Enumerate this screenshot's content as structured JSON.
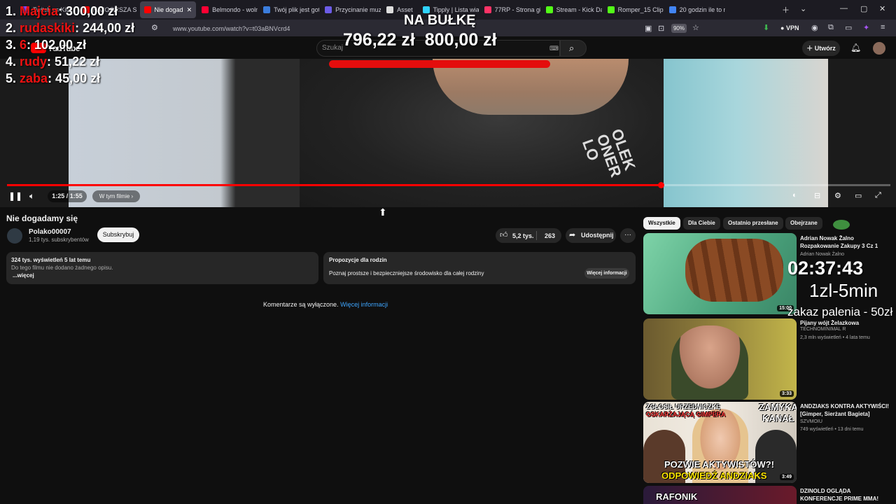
{
  "browser": {
    "tabs": [
      {
        "label": "Twitch vs Kick",
        "color": "#9146ff",
        "active": false
      },
      {
        "label": "NAJGORSZA S",
        "color": "#ff0000",
        "active": false
      },
      {
        "label": "Nie dogad",
        "color": "#ff0000",
        "active": true
      },
      {
        "label": "Belmondo - woln",
        "color": "#ff0033",
        "active": false
      },
      {
        "label": "Twój plik jest got",
        "color": "#3b7ddd",
        "active": false
      },
      {
        "label": "Przycinanie muzy",
        "color": "#6c5ce7",
        "active": false
      },
      {
        "label": "Asset",
        "color": "#dddddd",
        "active": false
      },
      {
        "label": "Tipply | Lista wiad",
        "color": "#2fd3ff",
        "active": false
      },
      {
        "label": "77RP - Strona głó",
        "color": "#ff3366",
        "active": false
      },
      {
        "label": "Stream - Kick Das",
        "color": "#53fc18",
        "active": false
      },
      {
        "label": "Romper_15 Clips",
        "color": "#53fc18",
        "active": false
      },
      {
        "label": "20 godzin ile to m",
        "color": "#4285f4",
        "active": false
      }
    ],
    "url": "www.youtube.com/watch?v=t03aBNVcrd4",
    "zoom": "90%",
    "vpn_label": "VPN"
  },
  "youtube": {
    "logo_text": "YouTube",
    "search_placeholder": "Szukaj",
    "create_label": "Utwórz"
  },
  "overlay": {
    "leaderboard": [
      {
        "rank": "1.",
        "name": "Majcia",
        "amount": ": 300,00 zł"
      },
      {
        "rank": "2.",
        "name": "rudaskiki",
        "amount": ": 244,00 zł"
      },
      {
        "rank": "3.",
        "name": "6",
        "amount": ": 102,00 zł"
      },
      {
        "rank": "4.",
        "name": "rudy",
        "amount": ": 51,22 zł"
      },
      {
        "rank": "5.",
        "name": "zaba",
        "amount": ": 45,00 zł"
      }
    ],
    "goal_title": "NA BUŁKĘ",
    "goal_current": "796,22 zł",
    "goal_target": "800,00 zł",
    "timer": "02:37:43",
    "rate": "1zl-5min",
    "rule": "zakaz palenia - 50zł"
  },
  "player": {
    "time": "1:25 / 1:55",
    "progress": 0.74,
    "chapter_label": "W tym filmie",
    "shirt_print": "OLEK ONER LO"
  },
  "video": {
    "title": "Nie dogadamy się",
    "channel": "Polako00007",
    "subscribers": "1,19 tys. subskrybentów",
    "subscribe_label": "Subskrybuj",
    "likes": "5,2 tys.",
    "dislikes": "263",
    "share_label": "Udostępnij",
    "more_label": "···"
  },
  "description": {
    "views_line": "324 tys. wyświetleń  5 lat temu",
    "text": "Do tego filmu nie dodano żadnego opisu.",
    "more": "...więcej"
  },
  "family_card": {
    "title": "Propozycje dla rodzin",
    "text": "Poznaj prostsze i bezpieczniejsze środowisko dla całej rodziny",
    "button": "Więcej informacji"
  },
  "comments": {
    "disabled_text": "Komentarze są wyłączone.",
    "link": "Więcej informacji"
  },
  "sidebar": {
    "chips": [
      "Wszystkie",
      "Dla Ciebie",
      "Ostatnio przesłane",
      "Obejrzane"
    ],
    "recommendations": [
      {
        "title": "Adrian Nowak Żalno Rozpakowanie Zakupy 3 Cz 1",
        "channel": "Adrian Nowak Żalno",
        "meta": "",
        "duration": "15:00"
      },
      {
        "title": "Pijany wójt Żelazkowa",
        "channel": "TECHNOMINIMAL R",
        "meta": "2,3 mln wyświetleń • 4 lata temu",
        "duration": "3:33"
      },
      {
        "title": "ANDZIAKS KONTRA AKTYWIŚCI! [Gimper, Sierżant Bagieta]",
        "channel": "SZVMOIU",
        "meta": "749 wyświetleń • 13 dni temu",
        "duration": "3:49",
        "captions": [
          "ZGŁOSIŁ URZĘDNICZKĘ",
          "OSKARŻAJĄCĄ GIMPERA",
          "ZAMYKA",
          "KANAŁ",
          "POZWIE AKTYWISTÓW?!",
          "ODPOWIEDŹ ANDZIAKS"
        ]
      },
      {
        "title": "DZINOLD OGLĄDA KONFERENCJE PRIME MMA!",
        "channel": "",
        "meta": "",
        "duration": "",
        "captions": [
          "RAFONIK"
        ]
      }
    ]
  }
}
